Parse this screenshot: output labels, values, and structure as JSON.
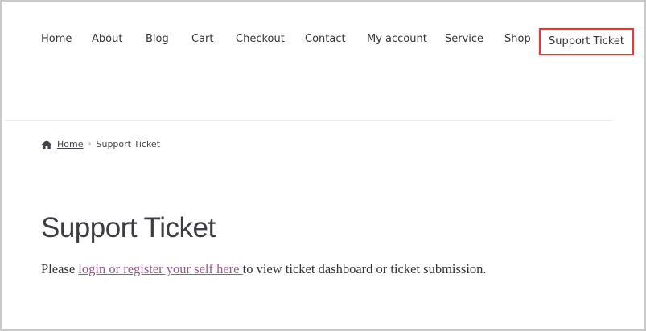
{
  "nav": {
    "items": [
      {
        "label": "Home"
      },
      {
        "label": "About"
      },
      {
        "label": "Blog"
      },
      {
        "label": "Cart"
      },
      {
        "label": "Checkout"
      },
      {
        "label": "Contact"
      },
      {
        "label": "My account"
      },
      {
        "label": "Service"
      },
      {
        "label": "Shop"
      },
      {
        "label": "Support Ticket"
      }
    ],
    "highlight_color": "#de3c3c"
  },
  "breadcrumb": {
    "icon": "home-icon",
    "home_label": "Home",
    "separator": "›",
    "current": "Support Ticket"
  },
  "page": {
    "title": "Support Ticket",
    "message_prefix": "Please ",
    "link_text": "login or register your self here ",
    "message_suffix": "to view ticket dashboard or ticket submission.",
    "link_color": "#96588a"
  }
}
